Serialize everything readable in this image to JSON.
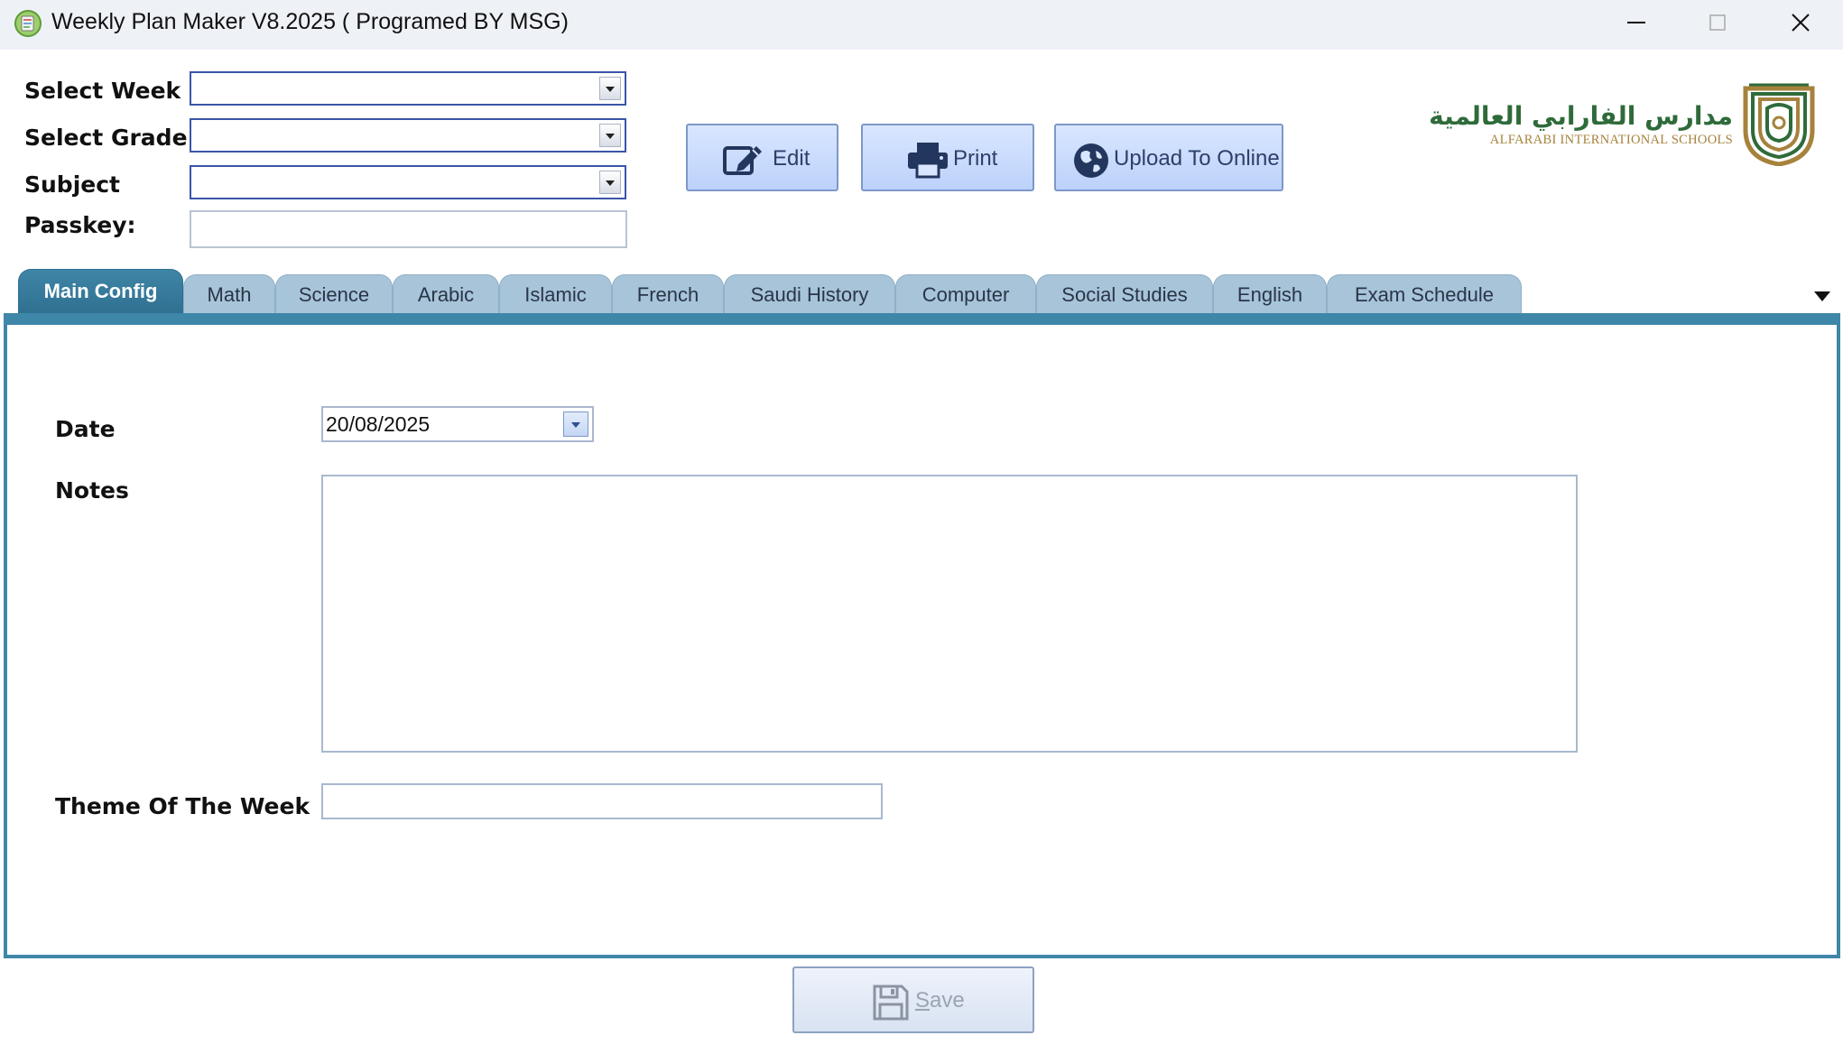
{
  "window": {
    "title": "Weekly Plan Maker V8.2025 ( Programed BY MSG)"
  },
  "top_form": {
    "week_label": "Select Week",
    "grade_label": "Select Grade",
    "subject_label": "Subject",
    "passkey_label": "Passkey:",
    "week_value": "",
    "grade_value": "",
    "subject_value": "",
    "passkey_value": ""
  },
  "toolbar": {
    "edit_label": "Edit",
    "print_label": "Print",
    "upload_label": "Upload To Online"
  },
  "logo": {
    "arabic_name": "مدارس الفارابي العالمية",
    "english_name": "ALFARABI INTERNATIONAL SCHOOLS"
  },
  "tabs": [
    {
      "label": "Main Config",
      "active": true
    },
    {
      "label": "Math",
      "active": false
    },
    {
      "label": "Science",
      "active": false
    },
    {
      "label": "Arabic",
      "active": false
    },
    {
      "label": "Islamic",
      "active": false
    },
    {
      "label": "French",
      "active": false
    },
    {
      "label": "Saudi History",
      "active": false
    },
    {
      "label": "Computer",
      "active": false
    },
    {
      "label": "Social Studies",
      "active": false
    },
    {
      "label": "English",
      "active": false
    },
    {
      "label": "Exam Schedule",
      "active": false
    }
  ],
  "main_config": {
    "date_label": "Date",
    "date_value": "20/08/2025",
    "notes_label": "Notes",
    "notes_value": "",
    "theme_label": "Theme Of The Week",
    "theme_value": ""
  },
  "footer": {
    "save_label": "Save"
  },
  "colors": {
    "tab_active": "#3f85a6",
    "tab_inactive": "#a7c4d8",
    "button_fill": "#c6d8fc",
    "logo_green": "#2f6b3a",
    "logo_gold": "#a6823c"
  }
}
